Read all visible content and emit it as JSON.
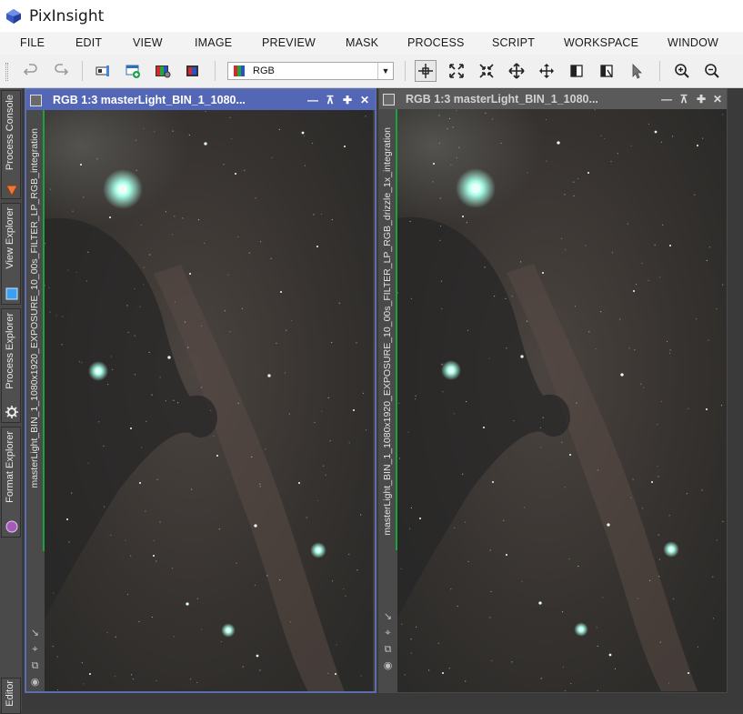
{
  "app": {
    "title": "PixInsight"
  },
  "menu": [
    "FILE",
    "EDIT",
    "VIEW",
    "IMAGE",
    "PREVIEW",
    "MASK",
    "PROCESS",
    "SCRIPT",
    "WORKSPACE",
    "WINDOW"
  ],
  "toolbar": {
    "channel_select": "RGB",
    "buttons": [
      "undo-icon",
      "redo-icon",
      "new-window-icon",
      "new-preview-icon",
      "rgb-channels-icon",
      "mask-icon",
      "readout-icon",
      "zoom-fit-icon",
      "zoom-fit-width-icon",
      "pan-icon",
      "center-icon",
      "crop-icon",
      "preview-mode-icon",
      "select-icon",
      "zoom-in-icon",
      "zoom-out-icon"
    ]
  },
  "sidebar": {
    "tabs": [
      {
        "label": "Process Console",
        "icon": "triangle-icon"
      },
      {
        "label": "View Explorer",
        "icon": "square-icon"
      },
      {
        "label": "Process Explorer",
        "icon": "gear-icon"
      },
      {
        "label": "Format Explorer",
        "icon": "circle-icon"
      },
      {
        "label": "Editor"
      }
    ]
  },
  "windows": [
    {
      "title": "RGB 1:3 masterLight_BIN_1_1080...",
      "side_label": "masterLight_BIN_1_1080x1920_EXPOSURE_10_00s_FILTER_LP_RGB_integration"
    },
    {
      "title": "RGB 1:3 masterLight_BIN_1_1080...",
      "side_label": "masterLight_BIN_1_1080x1920_EXPOSURE_10_00s_FILTER_LP_RGB_drizzle_1x_integration"
    }
  ],
  "colors": {
    "active_title": "#5467b6",
    "inactive_title": "#5a5a5a",
    "star_glow": "#a8ffe8",
    "nebula": "#5a4a46"
  }
}
